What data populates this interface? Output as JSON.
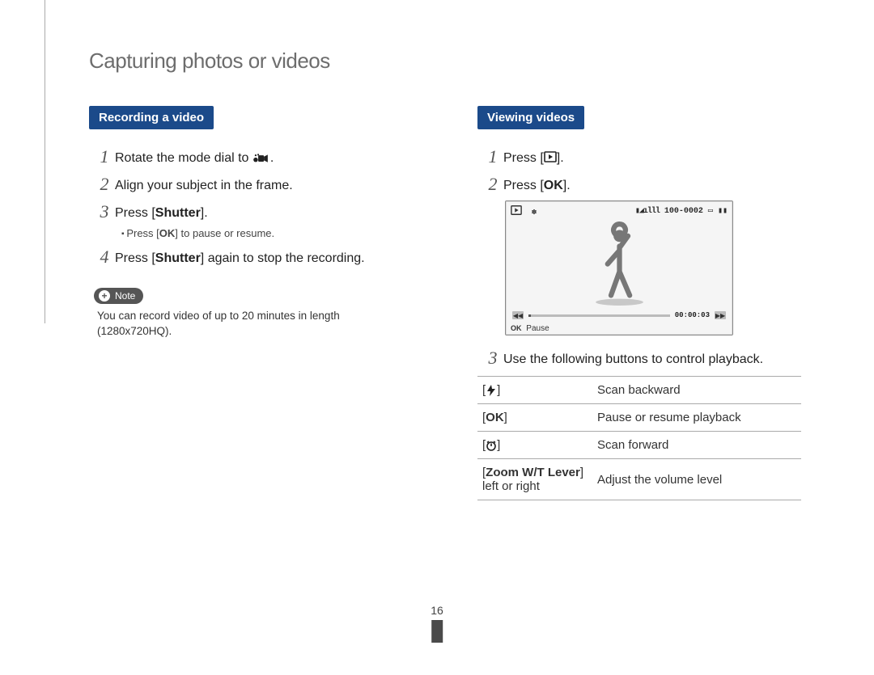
{
  "page_title": "Capturing photos or videos",
  "page_number": "16",
  "left": {
    "badge": "Recording a video",
    "steps": [
      {
        "num": "1",
        "text_before": "Rotate the mode dial to ",
        "icon": "video-mode",
        "text_after": "."
      },
      {
        "num": "2",
        "text_before": "Align your subject in the frame.",
        "text_after": ""
      },
      {
        "num": "3",
        "text_before": "Press [",
        "bold": "Shutter",
        "text_after": "]."
      },
      {
        "num": "4",
        "text_before": "Press [",
        "bold": "Shutter",
        "text_after": "] again to stop the recording."
      }
    ],
    "sub_bullet": {
      "before": "Press [",
      "ok": "OK",
      "after": "] to pause or resume."
    },
    "note_label": "Note",
    "note_text": "You can record video of up to 20 minutes in length (1280x720HQ)."
  },
  "right": {
    "badge": "Viewing videos",
    "steps": [
      {
        "num": "1",
        "text_before": "Press [",
        "icon": "playback",
        "text_after": "]."
      },
      {
        "num": "2",
        "text_before": "Press [",
        "ok": "OK",
        "text_after": "]."
      }
    ],
    "screen": {
      "top_left_icon": "playback",
      "signal": "▮◢ılll",
      "counter": "100-0002",
      "timecode": "00:00:03",
      "pause_label": "Pause",
      "ok": "OK"
    },
    "step3": {
      "num": "3",
      "text": "Use the following buttons to control playback."
    },
    "table": [
      {
        "key_icon": "flash",
        "desc": "Scan backward"
      },
      {
        "key_ok": "OK",
        "desc": "Pause or resume playback"
      },
      {
        "key_icon": "timer",
        "desc": "Scan forward"
      },
      {
        "key_text_bold": "Zoom W/T Lever",
        "key_text_line2": "left or right",
        "desc": "Adjust the volume level"
      }
    ]
  }
}
